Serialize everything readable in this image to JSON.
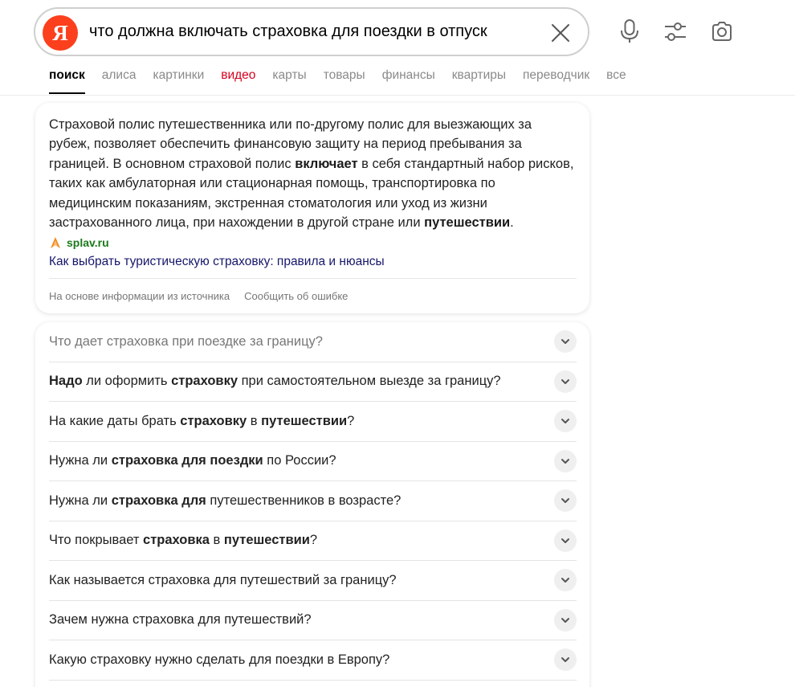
{
  "search": {
    "logo_letter": "Я",
    "query": "что должна включать страховка для поездки в отпуск"
  },
  "tabs": [
    {
      "label": "поиск",
      "state": "active"
    },
    {
      "label": "алиса"
    },
    {
      "label": "картинки"
    },
    {
      "label": "видео",
      "color": "#d6001c"
    },
    {
      "label": "карты"
    },
    {
      "label": "товары"
    },
    {
      "label": "финансы"
    },
    {
      "label": "квартиры"
    },
    {
      "label": "переводчик"
    },
    {
      "label": "все"
    }
  ],
  "answer": {
    "p1": "Страховой полис путешественника или по-другому полис для выезжающих за рубеж, позволяет обеспечить финансовую защиту на период пребывания за границей. В основном страховой полис ",
    "b1": "включает",
    "p2": " в себя стандартный набор рисков, таких как амбулаторная или стационарная помощь, транспортировка по медицинским показаниям, экстренная стоматология или уход из жизни застрахованного лица, при нахождении в другой стране или ",
    "b2": "путешествии",
    "p3": ".",
    "source_domain": "splav.ru",
    "source_title": "Как выбрать туристическую страховку: правила и нюансы",
    "footer_info": "На основе информации из источника",
    "footer_report": "Сообщить об ошибке"
  },
  "faq": [
    [
      {
        "t": "Что дает страховка при поездке за границу?"
      }
    ],
    [
      {
        "t": "Надо",
        "b": true
      },
      {
        "t": " ли оформить "
      },
      {
        "t": "страховку",
        "b": true
      },
      {
        "t": " при самостоятельном выезде за границу?"
      }
    ],
    [
      {
        "t": "На какие даты брать "
      },
      {
        "t": "страховку",
        "b": true
      },
      {
        "t": " в "
      },
      {
        "t": "путешествии",
        "b": true
      },
      {
        "t": "?"
      }
    ],
    [
      {
        "t": "Нужна ли "
      },
      {
        "t": "страховка для поездки",
        "b": true
      },
      {
        "t": " по России?"
      }
    ],
    [
      {
        "t": "Нужна ли "
      },
      {
        "t": "страховка для",
        "b": true
      },
      {
        "t": " путешественников в возрасте?"
      }
    ],
    [
      {
        "t": "Что покрывает "
      },
      {
        "t": "страховка",
        "b": true
      },
      {
        "t": " в "
      },
      {
        "t": "путешествии",
        "b": true
      },
      {
        "t": "?"
      }
    ],
    [
      {
        "t": "Как называется страховка для путешествий за границу?"
      }
    ],
    [
      {
        "t": "Зачем нужна страховка для путешествий?"
      }
    ],
    [
      {
        "t": "Какую страховку нужно сделать для поездки в Европу?"
      }
    ]
  ],
  "icons": {
    "clear": "close-icon",
    "mic": "microphone-icon",
    "filters": "filters-icon",
    "camera": "camera-icon",
    "chevron": "chevron-down-icon",
    "source": "splav-logo-icon"
  }
}
